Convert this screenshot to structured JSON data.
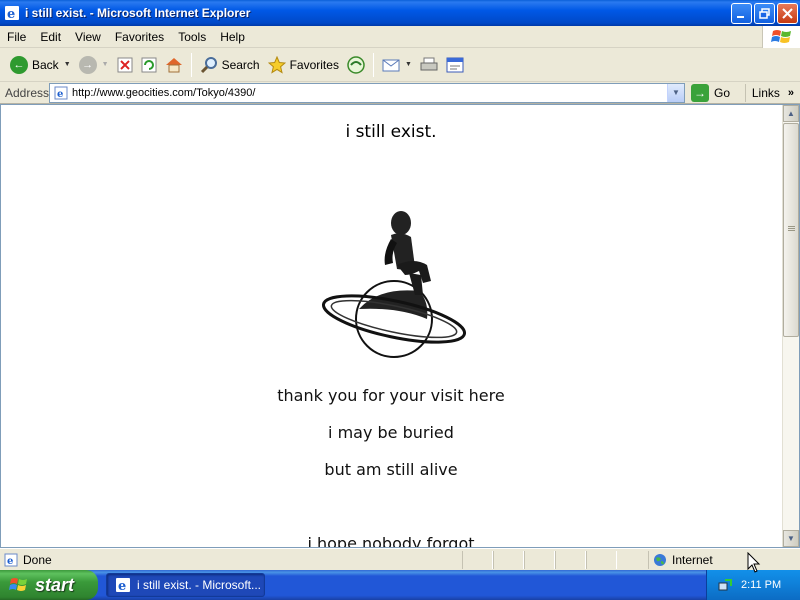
{
  "window": {
    "title": "i still exist. - Microsoft Internet Explorer"
  },
  "menu": [
    "File",
    "Edit",
    "View",
    "Favorites",
    "Tools",
    "Help"
  ],
  "toolbar": {
    "back_label": "Back",
    "search_label": "Search",
    "favorites_label": "Favorites"
  },
  "address": {
    "label": "Address",
    "url": "http://www.geocities.com/Tokyo/4390/",
    "go_label": "Go",
    "links_label": "Links"
  },
  "page": {
    "heading": "i still exist.",
    "lines": [
      "thank you for your visit here",
      "i may be buried",
      "but am still alive",
      "i hope nobody forgot"
    ]
  },
  "status": {
    "text": "Done",
    "zone": "Internet"
  },
  "taskbar": {
    "start_label": "start",
    "task_label": "i still exist. - Microsoft...",
    "clock": "2:11 PM"
  },
  "colors": {
    "titlebar": "#0058e6",
    "chrome": "#ece9d8",
    "taskbar": "#2157d7",
    "start": "#3a9a3a"
  }
}
